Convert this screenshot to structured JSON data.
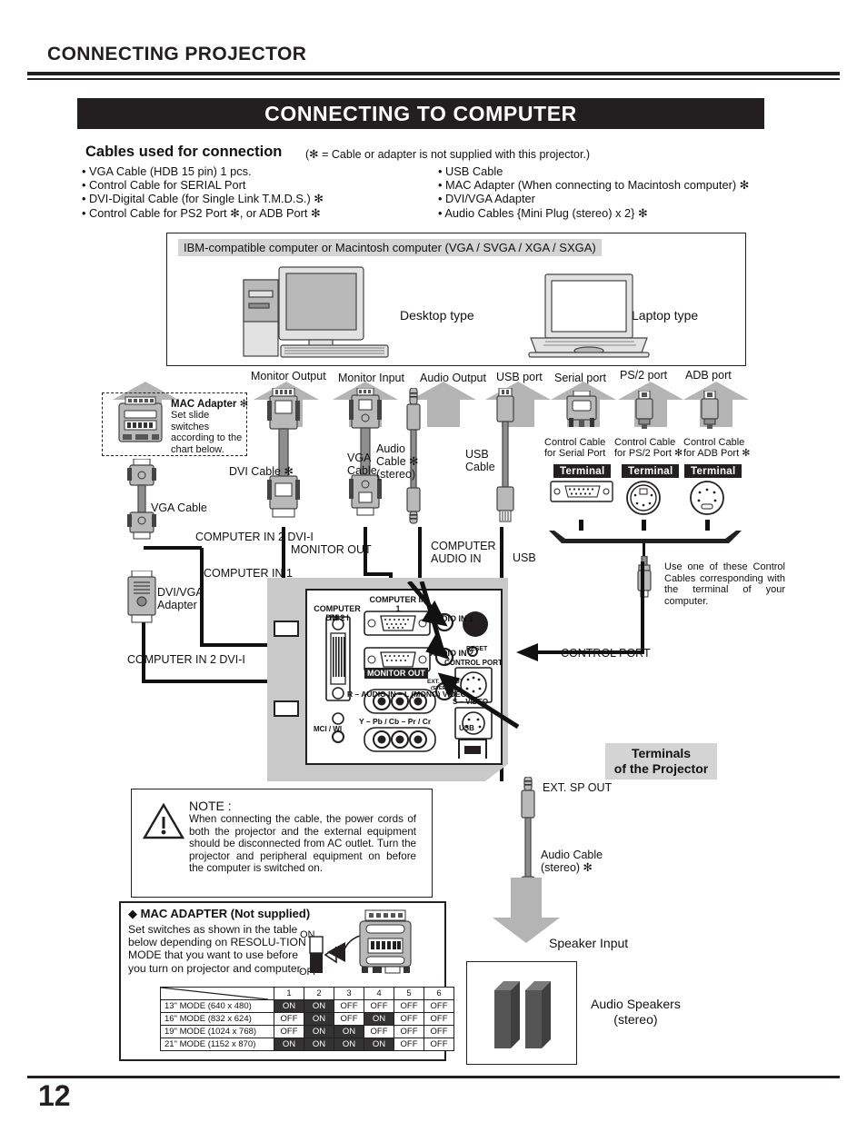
{
  "page": {
    "running_head": "CONNECTING PROJECTOR",
    "section_title": "CONNECTING TO COMPUTER",
    "page_number": "12"
  },
  "cables": {
    "title": "Cables used for connection",
    "note": "(✻ = Cable or adapter is not supplied with this projector.)",
    "left_column": [
      "• VGA Cable (HDB 15 pin) 1 pcs.",
      "• Control Cable for SERIAL Port",
      "• DVI-Digital Cable (for Single Link T.M.D.S.) ✻",
      "• Control Cable for PS2 Port ✻, or ADB Port ✻"
    ],
    "right_column": [
      "• USB Cable",
      "• MAC Adapter (When connecting to Macintosh computer)  ✻",
      "• DVI/VGA Adapter",
      "• Audio Cables {Mini Plug (stereo) x 2} ✻"
    ]
  },
  "computer_panel": {
    "caption": "IBM-compatible computer or Macintosh computer (VGA / SVGA / XGA / SXGA)",
    "desktop_label": "Desktop type",
    "laptop_label": "Laptop type"
  },
  "ports": {
    "monitor_output": "Monitor Output",
    "monitor_input": "Monitor Input",
    "audio_output": "Audio Output",
    "usb_port": "USB port",
    "serial_port": "Serial port",
    "ps2_port": "PS/2 port",
    "adb_port": "ADB port"
  },
  "mac_adapter_callout": {
    "title": "MAC Adapter ✻",
    "body": "Set slide switches according to the chart below."
  },
  "cable_labels": {
    "vga_cable_left": "VGA Cable",
    "dvi_cable": "DVI Cable ✻",
    "vga_cable": "VGA\nCable",
    "vga_cable_l1": "VGA",
    "vga_cable_l2": "Cable",
    "audio_cable_l1": "Audio",
    "audio_cable_l2": "Cable ✻",
    "audio_cable_l3": "(stereo)",
    "usb_cable_l1": "USB",
    "usb_cable_l2": "Cable",
    "dvi_vga_adapter_l1": "DVI/VGA",
    "dvi_vga_adapter_l2": "Adapter"
  },
  "control_cables": [
    {
      "l1": "Control Cable",
      "l2": "for Serial Port",
      "terminal": "Terminal"
    },
    {
      "l1": "Control Cable",
      "l2": "for PS/2 Port ✻",
      "terminal": "Terminal"
    },
    {
      "l1": "Control Cable",
      "l2": "for ADB Port ✻",
      "terminal": "Terminal"
    }
  ],
  "control_cable_note": "Use one of these Control Cables corresponding with the terminal of your computer.",
  "connection_labels": {
    "computer_in_2_dvi_i_top": "COMPUTER IN 2 DVI-I",
    "monitor_out": "MONITOR OUT",
    "computer_audio_in_l1": "COMPUTER",
    "computer_audio_in_l2": "AUDIO IN",
    "usb": "USB",
    "computer_in_1": "COMPUTER IN 1",
    "computer_in_2_dvi_i_bottom": "COMPUTER IN 2 DVI-I",
    "control_port": "CONTROL PORT",
    "ext_sp_out": "EXT. SP OUT",
    "speaker_input": "Speaker Input"
  },
  "terminal_panel": {
    "computer_in_1": "COMPUTER IN 1",
    "computer_in_2": "COMPUTER IN 2",
    "dvi_i": "DVI - I",
    "audio_in_1": "AUDIO IN 1",
    "audio_in_2": "AUDIO IN 2",
    "reset": "RESET",
    "control_port": "CONTROL PORT",
    "ext_sp_out_l1": "EXT. SP OUT",
    "ext_sp_out_l2": "(STEREO)",
    "monitor_out": "MONITOR OUT",
    "audio_in_row": "R – AUDIO IN – L (MONO)  VIDEO",
    "component_row": "Y  –  Pb / Cb  –  Pr / Cr",
    "s_video": "S – VIDEO",
    "usb": "USB",
    "mci_wi": "MCI / WI"
  },
  "terminals_badge_l1": "Terminals",
  "terminals_badge_l2": "of the Projector",
  "note": {
    "title": "NOTE :",
    "body": "When connecting the cable, the power cords of both the projector and the external equipment should be disconnected from AC outlet.  Turn the projector and peripheral equipment on before the computer is switched on."
  },
  "audio_cable_bottom": {
    "l1": "Audio Cable",
    "l2": "(stereo) ✻"
  },
  "speakers": {
    "l1": "Audio Speakers",
    "l2": "(stereo)"
  },
  "mac_adapter_box": {
    "title": "◆ MAC ADAPTER (Not supplied)",
    "description": "Set switches as shown in the table below depending on RESOLU-TION MODE that you want to use before you turn on projector and computer.",
    "on_label": "ON",
    "off_label": "OFF",
    "table": {
      "headers": [
        "",
        "1",
        "2",
        "3",
        "4",
        "5",
        "6"
      ],
      "rows": [
        {
          "mode": "13\" MODE (640 x 480)",
          "switches": [
            "ON",
            "ON",
            "OFF",
            "OFF",
            "OFF",
            "OFF"
          ]
        },
        {
          "mode": "16\" MODE (832 x 624)",
          "switches": [
            "OFF",
            "ON",
            "OFF",
            "ON",
            "OFF",
            "OFF"
          ]
        },
        {
          "mode": "19\" MODE (1024 x 768)",
          "switches": [
            "OFF",
            "ON",
            "ON",
            "OFF",
            "OFF",
            "OFF"
          ]
        },
        {
          "mode": "21\" MODE (1152 x 870)",
          "switches": [
            "ON",
            "ON",
            "ON",
            "ON",
            "OFF",
            "OFF"
          ]
        }
      ]
    }
  },
  "colors": {
    "ink": "#231f20",
    "arrow_gray": "#b4b4b4",
    "panel_gray": "#c9c9c9",
    "caption_gray": "#d4d4d4",
    "connector_gray": "#8e8e8e"
  }
}
